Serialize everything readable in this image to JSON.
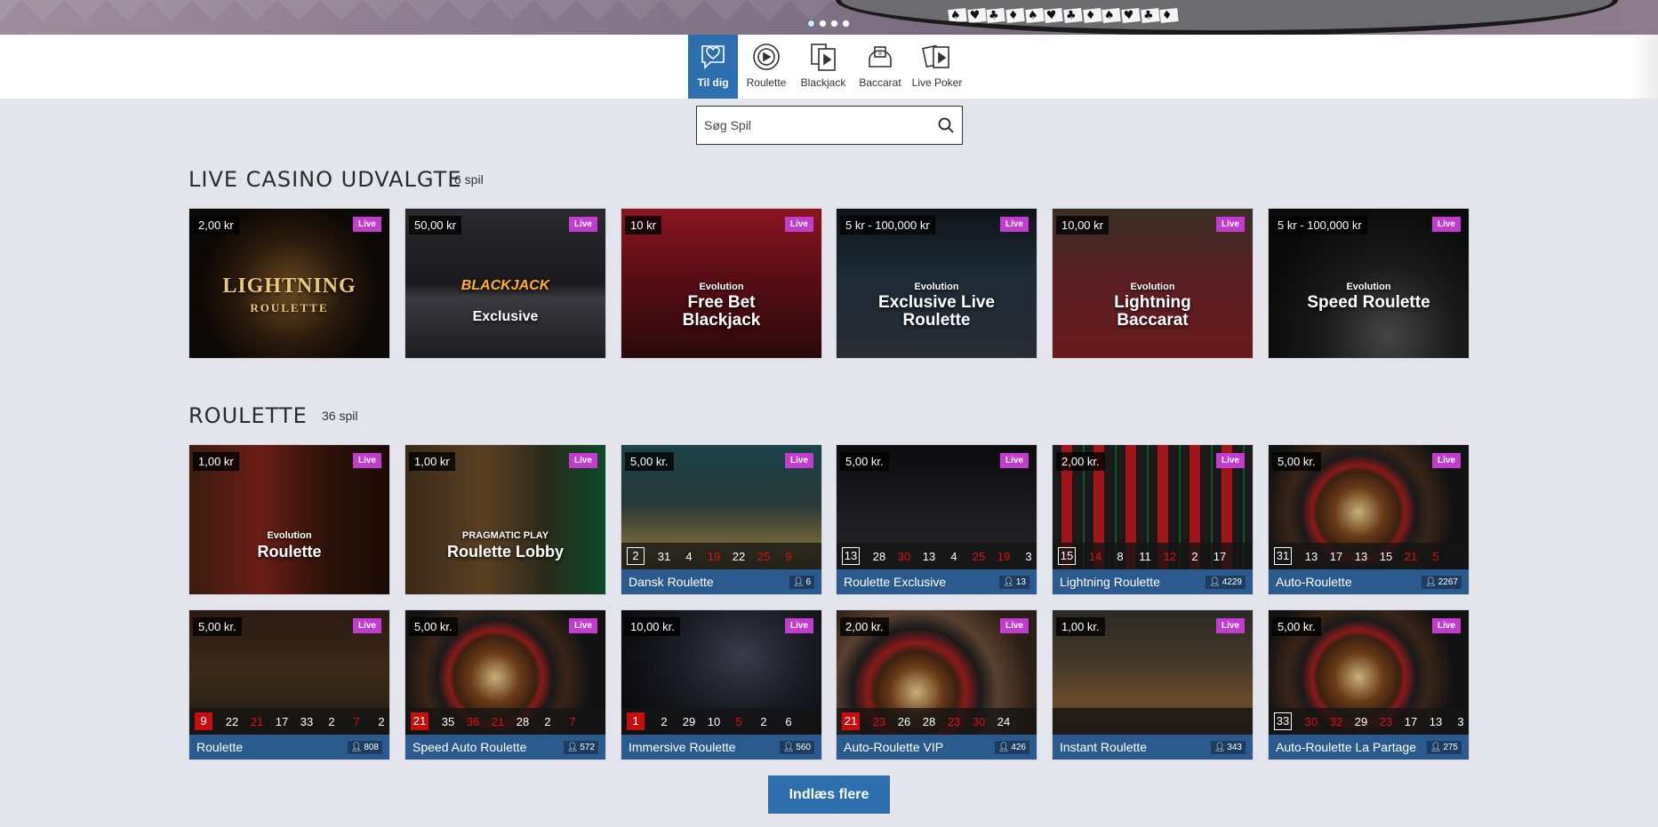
{
  "hero": {
    "carousel_dots": 4,
    "active_dot": 0
  },
  "categories": [
    {
      "label": "Til dig",
      "icon": "heart-bubble-icon",
      "active": true
    },
    {
      "label": "Roulette",
      "icon": "roulette-wheel-icon"
    },
    {
      "label": "Blackjack",
      "icon": "cards-play-icon"
    },
    {
      "label": "Baccarat",
      "icon": "baccarat-icon"
    },
    {
      "label": "Live Poker",
      "icon": "poker-cards-icon"
    }
  ],
  "search": {
    "placeholder": "Søg Spil"
  },
  "sections": [
    {
      "title": "LIVE CASINO UDVALGTE",
      "count": "6 spil",
      "games": [
        {
          "price": "2,00 kr",
          "badge": "Live",
          "art_title": "LIGHTNING",
          "art_sub": "ROULETTE",
          "theme": "lightning"
        },
        {
          "price": "50,00 kr",
          "badge": "Live",
          "art_title": "BLACKJACK",
          "art_sub": "Exclusive",
          "theme": "blackjack"
        },
        {
          "price": "10 kr",
          "badge": "Live",
          "art_brand": "Evolution",
          "art_title": "Free Bet Blackjack",
          "theme": "freebet"
        },
        {
          "price": "5 kr - 100,000 kr",
          "badge": "Live",
          "art_brand": "Evolution",
          "art_title": "Exclusive Live Roulette",
          "theme": "exclusive"
        },
        {
          "price": "10,00 kr",
          "badge": "Live",
          "art_brand": "Evolution",
          "art_title": "Lightning Baccarat",
          "theme": "baccarat"
        },
        {
          "price": "5 kr - 100,000 kr",
          "badge": "Live",
          "art_brand": "Evolution",
          "art_title": "Speed Roulette",
          "theme": "speed"
        }
      ]
    },
    {
      "title": "ROULETTE",
      "count": "36 spil",
      "games": [
        {
          "price": "1,00 kr",
          "badge": "Live",
          "art_brand": "Evolution",
          "art_title": "Roulette",
          "theme": "redroom"
        },
        {
          "price": "1,00 kr",
          "badge": "Live",
          "art_brand": "PRAGMATIC PLAY",
          "art_title": "Roulette Lobby",
          "theme": "lobby"
        },
        {
          "price": "5,00 kr.",
          "badge": "Live",
          "name": "Dansk Roulette",
          "players": "6",
          "results": [
            "2",
            "31",
            "4",
            "19",
            "22",
            "25",
            "9"
          ],
          "reds": [
            3,
            5,
            6
          ],
          "theme": "dansk"
        },
        {
          "price": "5,00 kr.",
          "badge": "Live",
          "name": "Roulette Exclusive",
          "players": "13",
          "results": [
            "13",
            "28",
            "30",
            "13",
            "4",
            "25",
            "19",
            "3"
          ],
          "reds": [
            2,
            5,
            6
          ],
          "theme": "dark"
        },
        {
          "price": "2,00 kr.",
          "badge": "Live",
          "name": "Lightning Roulette",
          "players": "4229",
          "results": [
            "15",
            "14",
            "8",
            "11",
            "12",
            "2",
            "17"
          ],
          "reds": [
            1,
            4
          ],
          "theme": "board"
        },
        {
          "price": "5,00 kr.",
          "badge": "Live",
          "name": "Auto-Roulette",
          "players": "2267",
          "results": [
            "31",
            "13",
            "17",
            "13",
            "15",
            "21",
            "5"
          ],
          "reds": [
            5,
            6
          ],
          "theme": "wheel"
        },
        {
          "price": "5,00 kr.",
          "badge": "Live",
          "name": "Roulette",
          "players": "808",
          "results": [
            "9",
            "22",
            "21",
            "17",
            "33",
            "2",
            "7",
            "2"
          ],
          "reds": [
            0,
            2,
            6
          ],
          "theme": "dealer"
        },
        {
          "price": "5,00 kr.",
          "badge": "Live",
          "name": "Speed Auto Roulette",
          "players": "572",
          "results": [
            "21",
            "35",
            "36",
            "21",
            "28",
            "2",
            "7"
          ],
          "reds": [
            0,
            2,
            3,
            6
          ],
          "theme": "wheel"
        },
        {
          "price": "10,00 kr.",
          "badge": "Live",
          "name": "Immersive Roulette",
          "players": "560",
          "results": [
            "1",
            "2",
            "29",
            "10",
            "5",
            "2",
            "6"
          ],
          "reds": [
            0,
            4
          ],
          "theme": "immersive"
        },
        {
          "price": "2,00 kr.",
          "badge": "Live",
          "name": "Auto-Roulette VIP",
          "players": "426",
          "results": [
            "21",
            "23",
            "26",
            "28",
            "23",
            "30",
            "24"
          ],
          "reds": [
            0,
            1,
            4,
            5
          ],
          "theme": "wheel2"
        },
        {
          "price": "1,00 kr.",
          "badge": "Live",
          "name": "Instant Roulette",
          "players": "343",
          "results": [],
          "reds": [],
          "theme": "instant"
        },
        {
          "price": "5,00 kr.",
          "badge": "Live",
          "name": "Auto-Roulette La Partage",
          "players": "275",
          "results": [
            "33",
            "30",
            "32",
            "29",
            "23",
            "17",
            "13",
            "3"
          ],
          "reds": [
            1,
            2,
            4
          ],
          "theme": "wheel"
        }
      ]
    }
  ],
  "load_more": "Indlæs flere",
  "colors": {
    "accent": "#2e6fb0",
    "live_badge": "#c33cd0",
    "name_bar": "#2b5b8e",
    "background": "#e3e4ec"
  }
}
